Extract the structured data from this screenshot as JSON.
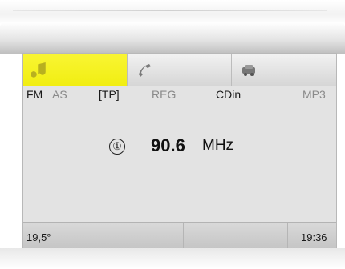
{
  "screen": {
    "buttons": [
      {
        "icon": "music-note-icon",
        "active": true
      },
      {
        "icon": "phone-handset-icon",
        "active": false
      },
      {
        "icon": "navigation-car-icon",
        "active": false
      }
    ],
    "modes": {
      "fm": "FM",
      "as": "AS",
      "tp": "[TP]",
      "reg": "REG",
      "cdin": "CDin",
      "mp3": "MP3"
    },
    "tuner": {
      "preset": "①",
      "frequency": "90.6",
      "unit": "MHz"
    },
    "status": {
      "temperature": "19,5°",
      "time": "19:36"
    },
    "colors": {
      "active_tab": "#f1ee12",
      "screen_bg": "#e3e3e3"
    }
  }
}
